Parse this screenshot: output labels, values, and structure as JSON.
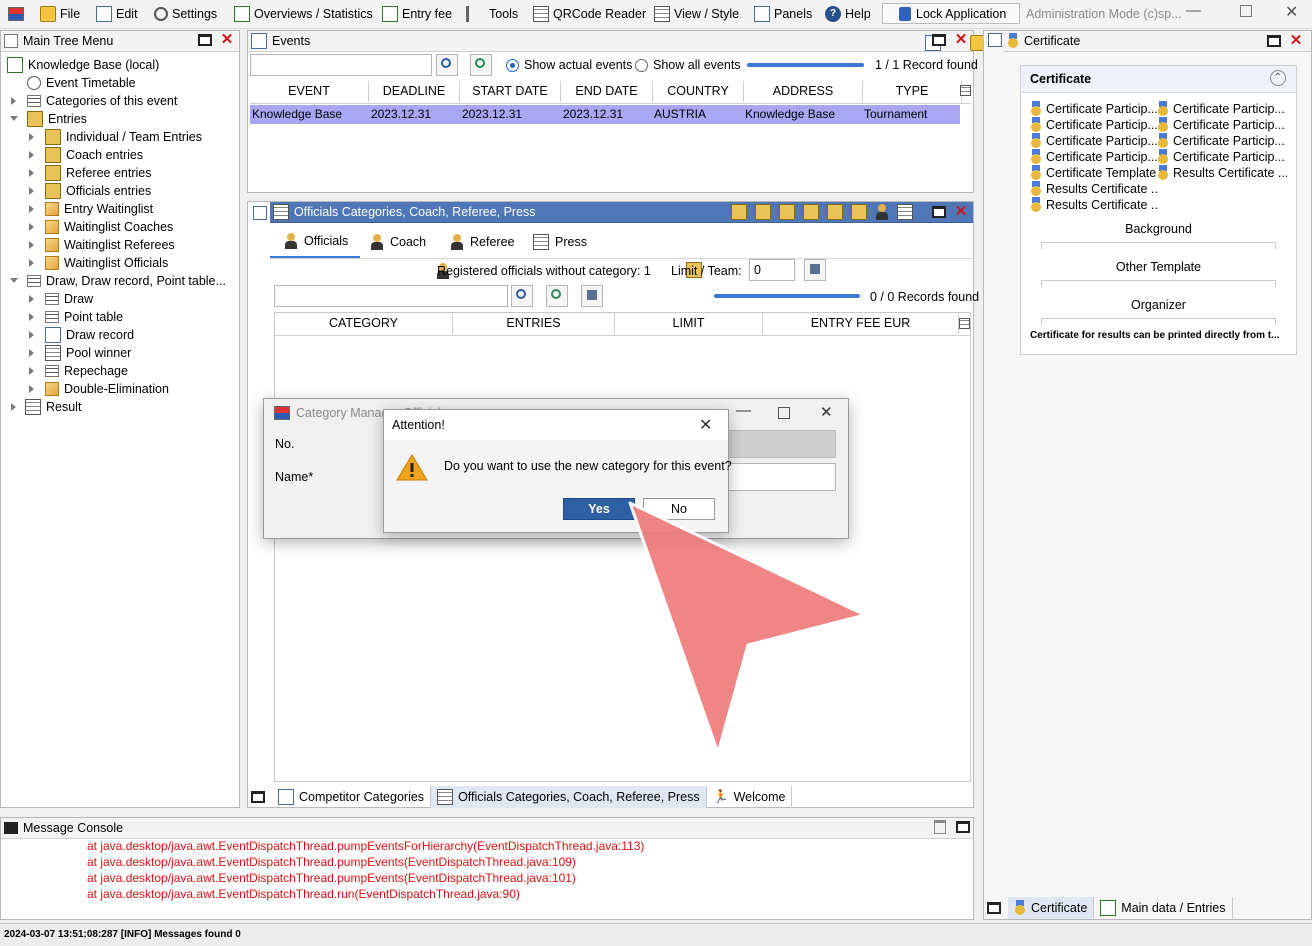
{
  "menubar": {
    "items": [
      "File",
      "Edit",
      "Settings",
      "Overviews / Statistics",
      "Entry fee",
      "Tools",
      "QRCode Reader",
      "View / Style",
      "Panels",
      "Help"
    ],
    "lock_label": "Lock Application",
    "mode_text": "Administration Mode (c)sp..."
  },
  "tree_panel": {
    "title": "Main Tree Menu",
    "items": [
      "Knowledge Base (local)",
      "Event Timetable",
      "Categories of this event",
      "Entries",
      "Individual / Team Entries",
      "Coach entries",
      "Referee entries",
      "Officials entries",
      "Entry Waitinglist",
      "Waitinglist Coaches",
      "Waitinglist Referees",
      "Waitinglist Officials",
      "Draw, Draw record, Point table...",
      "Draw",
      "Point table",
      "Draw record",
      "Pool winner",
      "Repechage",
      "Double-Elimination",
      "Result"
    ]
  },
  "events_panel": {
    "title": "Events",
    "radio_actual": "Show actual events",
    "radio_all": "Show all events",
    "record_count": "1 / 1 Record found",
    "columns": [
      "EVENT",
      "DEADLINE",
      "START DATE",
      "END DATE",
      "COUNTRY",
      "ADDRESS",
      "TYPE"
    ],
    "row": [
      "Knowledge Base",
      "2023.12.31",
      "2023.12.31",
      "2023.12.31",
      "AUSTRIA",
      "Knowledge Base",
      "Tournament"
    ]
  },
  "officials_panel": {
    "title": "Officials Categories, Coach, Referee, Press",
    "tabs": [
      "Officials",
      "Coach",
      "Referee",
      "Press"
    ],
    "registered_text": "Registered officials without category: 1",
    "limit_label": "Limit / Team:",
    "limit_value": "0",
    "record_count": "0 / 0 Records found",
    "columns": [
      "CATEGORY",
      "ENTRIES",
      "LIMIT",
      "ENTRY FEE EUR"
    ],
    "bottom_tabs": [
      "Competitor Categories",
      "Officials Categories, Coach, Referee, Press",
      "Welcome"
    ]
  },
  "certificate_panel": {
    "title": "Certificate",
    "section_title": "Certificate",
    "items_left": [
      "Certificate Particip...",
      "Certificate Particip...",
      "Certificate Particip...",
      "Certificate Particip...",
      "Certificate Template",
      "Results Certificate ...",
      "Results Certificate ..."
    ],
    "items_right": [
      "Certificate Particip...",
      "Certificate Particip...",
      "Certificate Particip...",
      "Certificate Particip...",
      "Results Certificate ..."
    ],
    "label_background": "Background",
    "label_other": "Other Template",
    "label_organizer": "Organizer",
    "note": "Certificate for results can be printed directly from t...",
    "bottom_tabs": [
      "Certificate",
      "Main data / Entries"
    ]
  },
  "console": {
    "title": "Message Console",
    "lines": [
      "at java.desktop/java.awt.EventDispatchThread.pumpEventsForHierarchy(EventDispatchThread.java:113)",
      "at java.desktop/java.awt.EventDispatchThread.pumpEvents(EventDispatchThread.java:109)",
      "at java.desktop/java.awt.EventDispatchThread.pumpEvents(EventDispatchThread.java:101)",
      "at java.desktop/java.awt.EventDispatchThread.run(EventDispatchThread.java:90)"
    ]
  },
  "status_bar": "2024-03-07 13:51:08:287 [INFO] Messages found 0",
  "category_dialog": {
    "title": "Category Manager Officials",
    "label_no": "No.",
    "label_name": "Name*"
  },
  "attention_dialog": {
    "title": "Attention!",
    "message": "Do you want to use the new category for this event?",
    "yes": "Yes",
    "no": "No"
  },
  "colors": {
    "accent": "#4f77b8",
    "selected_row": "#a9a6f3",
    "error_text": "#dd1111",
    "pointer": "#ef7b7b"
  }
}
